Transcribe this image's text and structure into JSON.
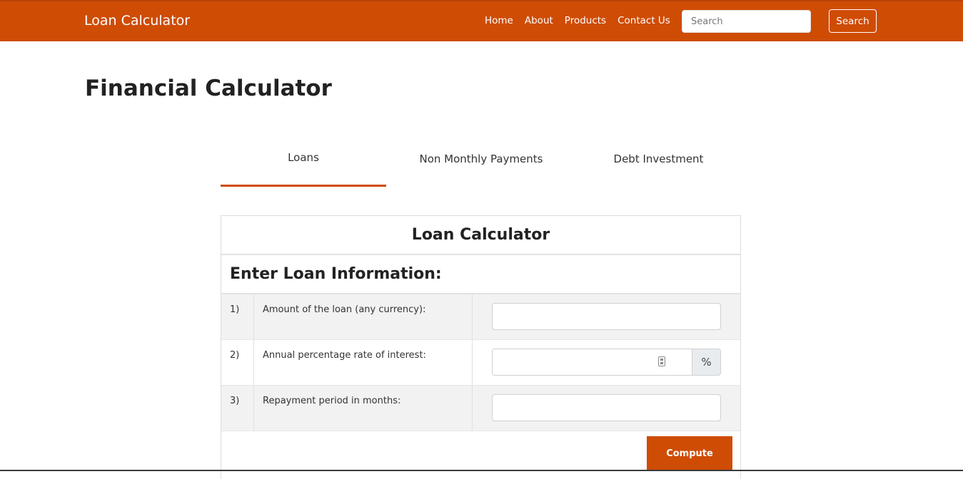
{
  "navbar": {
    "brand": "Loan Calculator",
    "links": [
      "Home",
      "About",
      "Products",
      "Contact Us"
    ],
    "search_placeholder": "Search",
    "search_button": "Search"
  },
  "page": {
    "title": "Financial Calculator"
  },
  "tabs": [
    {
      "label": "Loans",
      "active": true
    },
    {
      "label": "Non Monthly Payments",
      "active": false
    },
    {
      "label": "Debt Investment",
      "active": false
    }
  ],
  "calculator": {
    "title": "Loan Calculator",
    "section_title": "Enter Loan Information:",
    "rows": [
      {
        "num": "1)",
        "label": "Amount of the loan (any currency):",
        "value": ""
      },
      {
        "num": "2)",
        "label": "Annual percentage rate of interest:",
        "value": "",
        "addon": "%"
      },
      {
        "num": "3)",
        "label": "Repayment period in months:",
        "value": ""
      }
    ],
    "compute_button": "Compute"
  },
  "colors": {
    "accent": "#cf4c05"
  }
}
